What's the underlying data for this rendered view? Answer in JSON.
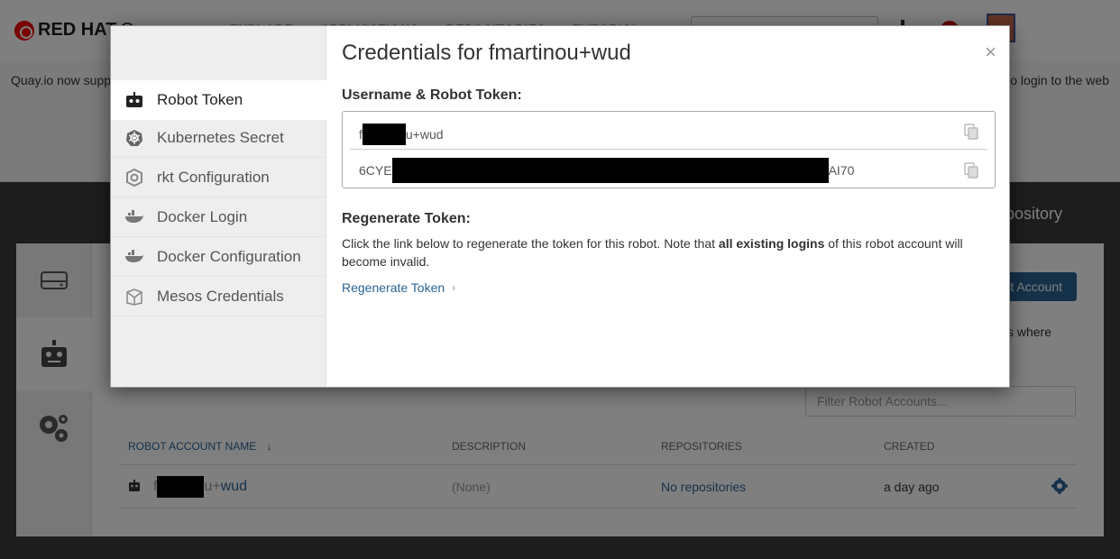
{
  "header": {
    "logo_text": "RED HAT",
    "logo_suffix": "Quay",
    "nav": [
      "EXPLORE",
      "APPLICATIONS",
      "REPOSITORIES",
      "TUTORIAL"
    ]
  },
  "banner": {
    "left_text": "Quay.io now supp",
    "right_text": "o login to the web"
  },
  "page": {
    "create_repo_text": "epository",
    "create_robot_button": "t Account",
    "info_text": "s where",
    "filter_placeholder": "Filter Robot Accounts...",
    "table": {
      "headers": [
        "ROBOT ACCOUNT NAME",
        "DESCRIPTION",
        "REPOSITORIES",
        "CREATED"
      ],
      "sort_indicator": "↓",
      "rows": [
        {
          "name_prefix": "f",
          "name_suffix_muted": "u+",
          "name_suffix": "wud",
          "description": "(None)",
          "repositories": "No repositories",
          "created": "a day ago"
        }
      ]
    }
  },
  "modal": {
    "title": "Credentials for fmartinou+wud",
    "close": "×",
    "tabs": [
      {
        "label": "Robot Token",
        "icon": "robot-icon",
        "active": true
      },
      {
        "label": "Kubernetes Secret",
        "icon": "kubernetes-icon",
        "active": false
      },
      {
        "label": "rkt Configuration",
        "icon": "rkt-icon",
        "active": false
      },
      {
        "label": "Docker Login",
        "icon": "docker-icon",
        "active": false
      },
      {
        "label": "Docker Configuration",
        "icon": "docker-icon",
        "active": false
      },
      {
        "label": "Mesos Credentials",
        "icon": "mesos-icon",
        "active": false
      }
    ],
    "credentials_label": "Username & Robot Token:",
    "username_prefix": "f",
    "username_suffix": "u+wud",
    "token_prefix": "6CYE",
    "token_suffix": "AI70",
    "regenerate_label": "Regenerate Token:",
    "regenerate_text_1": "Click the link below to regenerate the token for this robot. Note that ",
    "regenerate_text_bold": "all existing logins",
    "regenerate_text_2": " of this robot account will become invalid.",
    "regenerate_link": "Regenerate Token",
    "regenerate_chevron": "›"
  },
  "colors": {
    "link": "#2a6496",
    "overlay": "rgba(0,0,0,0.5)",
    "brand_red": "#ee0000"
  }
}
